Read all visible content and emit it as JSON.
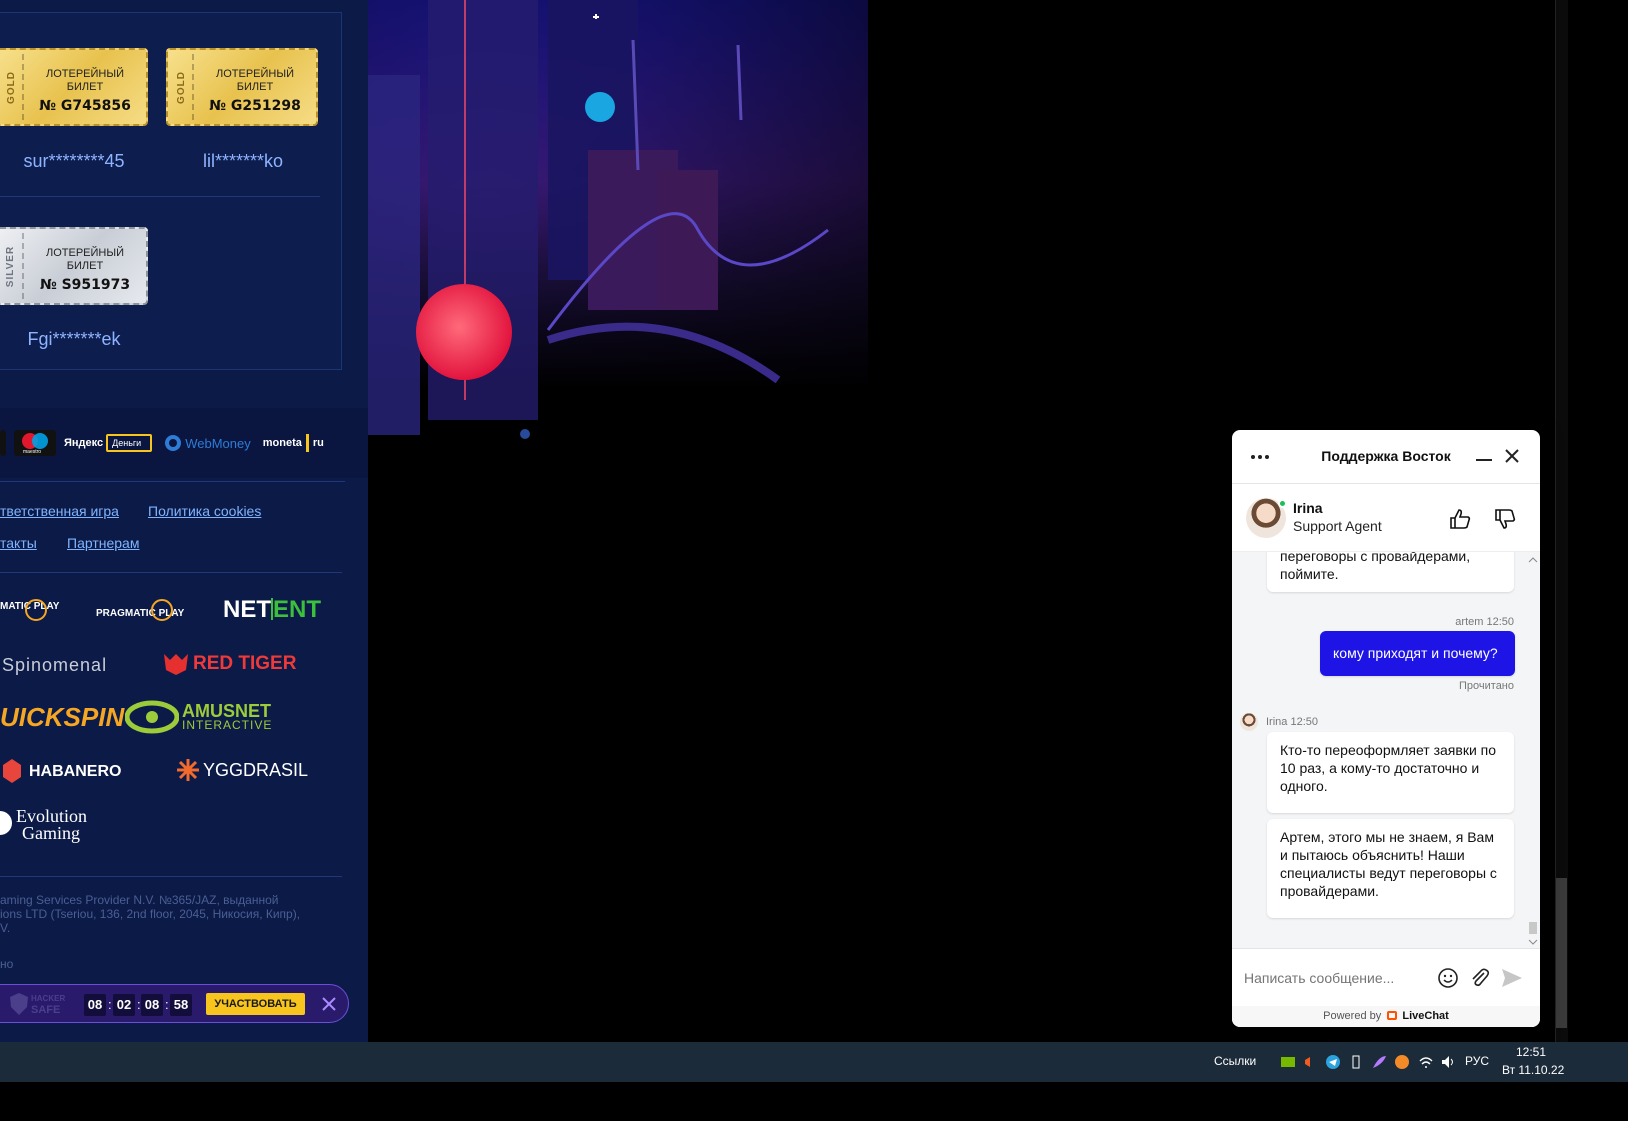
{
  "winners": {
    "tickets": [
      {
        "type": "GOLD",
        "line1": "ЛОТЕРЕЙНЫЙ",
        "line2": "БИЛЕТ",
        "number": "№ G745856",
        "user": "sur********45"
      },
      {
        "type": "GOLD",
        "line1": "ЛОТЕРЕЙНЫЙ",
        "line2": "БИЛЕТ",
        "number": "№ G251298",
        "user": "lil*******ko"
      },
      {
        "type": "SILVER",
        "line1": "ЛОТЕРЕЙНЫЙ",
        "line2": "БИЛЕТ",
        "number": "№ S951973",
        "user": "Fgi*******ek"
      }
    ]
  },
  "payments": {
    "yandex": "Яндекс",
    "yandex_money": "Деньги",
    "webmoney": "WebMoney",
    "moneta": "moneta",
    "moneta_ru": "ru",
    "maestro": "maestro"
  },
  "footer_links": {
    "responsible": "тветственная игра",
    "cookies": "Политика cookies",
    "contacts": "такты",
    "partners": "Партнерам"
  },
  "providers": {
    "pragmatic1": "MATIC PLAY",
    "pragmatic2": "PRAGMATIC PLAY",
    "netent_a": "NET",
    "netent_b": "ENT",
    "spinomenal": "Spinomenal",
    "redtiger": "RED TIGER",
    "quickspin": "UICKSPIN",
    "amusnet1": "AMUSNET",
    "amusnet2": "INTERACTIVE",
    "habanero": "HABANERO",
    "yggdrasil": "YGGDRASIL",
    "evolution1": "Evolution",
    "evolution2": "Gaming"
  },
  "legal": {
    "line1": "aming Services Provider N.V. №365/JAZ, выданной",
    "line2": "ions LTD (Tseriou, 136, 2nd floor, 2045, Никосия, Кипр),",
    "line3": "V.",
    "line4": "но"
  },
  "promo": {
    "badge1": "HACKER",
    "badge2": "SAFE",
    "timer": [
      "08",
      "02",
      "08",
      "58"
    ],
    "sep": ":",
    "button": "УЧАСТВОВАТЬ"
  },
  "chat": {
    "title": "Поддержка Восток",
    "agent_name": "Irina",
    "agent_role": "Support Agent",
    "messages": {
      "partial": "переговоры с провайдерами,\nпоймите.",
      "user_meta": "artem 12:50",
      "user_msg": "кому приходят и почему?",
      "read_status": "Прочитано",
      "agent_meta": "Irina 12:50",
      "agent_msg1": "Кто-то переоформляет заявки по 10 раз, а кому-то достаточно и одного.",
      "agent_msg2": "Артем, этого мы не знаем, я Вам и пытаюсь объяснить! Наши специалисты ведут переговоры с провайдерами."
    },
    "input_placeholder": "Написать сообщение...",
    "powered_prefix": "Powered by",
    "powered_brand": "LiveChat"
  },
  "taskbar": {
    "links": "Ссылки",
    "lang": "РУС",
    "time": "12:51",
    "date": "Вт 11.10.22"
  },
  "colors": {
    "panel": "#0c1a47",
    "link": "#7fb4ff",
    "chat_user_bubble": "#1e14e6",
    "promo_button": "#f7c51d"
  }
}
